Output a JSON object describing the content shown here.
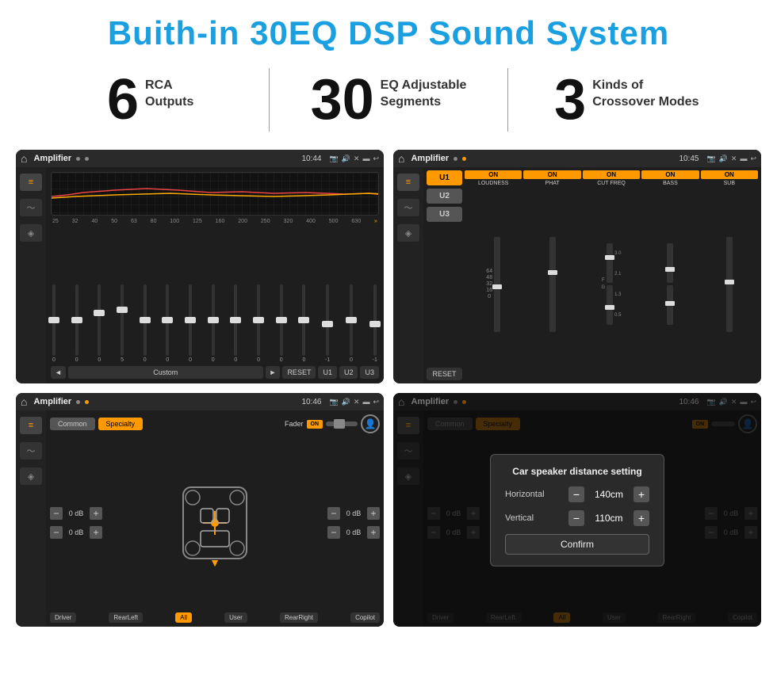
{
  "page": {
    "title": "Buith-in 30EQ DSP Sound System",
    "stats": [
      {
        "number": "6",
        "label": "RCA\nOutputs"
      },
      {
        "number": "30",
        "label": "EQ Adjustable\nSegments"
      },
      {
        "number": "3",
        "label": "Kinds of\nCrossover Modes"
      }
    ]
  },
  "screens": {
    "screen1": {
      "title": "Amplifier",
      "time": "10:44",
      "eq_labels": [
        "25",
        "32",
        "40",
        "50",
        "63",
        "80",
        "100",
        "125",
        "160",
        "200",
        "250",
        "320",
        "400",
        "500",
        "630"
      ],
      "eq_values": [
        "0",
        "0",
        "0",
        "5",
        "0",
        "0",
        "0",
        "0",
        "0",
        "0",
        "0",
        "0",
        "-1",
        "0",
        "-1"
      ],
      "bottom_btns": [
        "◄",
        "Custom",
        "►",
        "RESET",
        "U1",
        "U2",
        "U3"
      ]
    },
    "screen2": {
      "title": "Amplifier",
      "time": "10:45",
      "u_btns": [
        "U1",
        "U2",
        "U3"
      ],
      "channels": [
        "LOUDNESS",
        "PHAT",
        "CUT FREQ",
        "BASS",
        "SUB"
      ],
      "reset": "RESET"
    },
    "screen3": {
      "title": "Amplifier",
      "time": "10:46",
      "tabs": [
        "Common",
        "Specialty"
      ],
      "fader": "Fader",
      "fader_on": "ON",
      "db_values": [
        "0 dB",
        "0 dB",
        "0 dB",
        "0 dB"
      ],
      "positions": [
        "Driver",
        "RearLeft",
        "All",
        "User",
        "RearRight",
        "Copilot"
      ]
    },
    "screen4": {
      "title": "Amplifier",
      "time": "10:46",
      "tabs": [
        "Common",
        "Specialty"
      ],
      "dialog": {
        "title": "Car speaker distance setting",
        "horizontal_label": "Horizontal",
        "horizontal_value": "140cm",
        "vertical_label": "Vertical",
        "vertical_value": "110cm",
        "confirm": "Confirm"
      },
      "db_values": [
        "0 dB",
        "0 dB"
      ],
      "positions": [
        "Driver",
        "RearLeft",
        "All",
        "User",
        "RearRight",
        "Copilot"
      ]
    }
  }
}
